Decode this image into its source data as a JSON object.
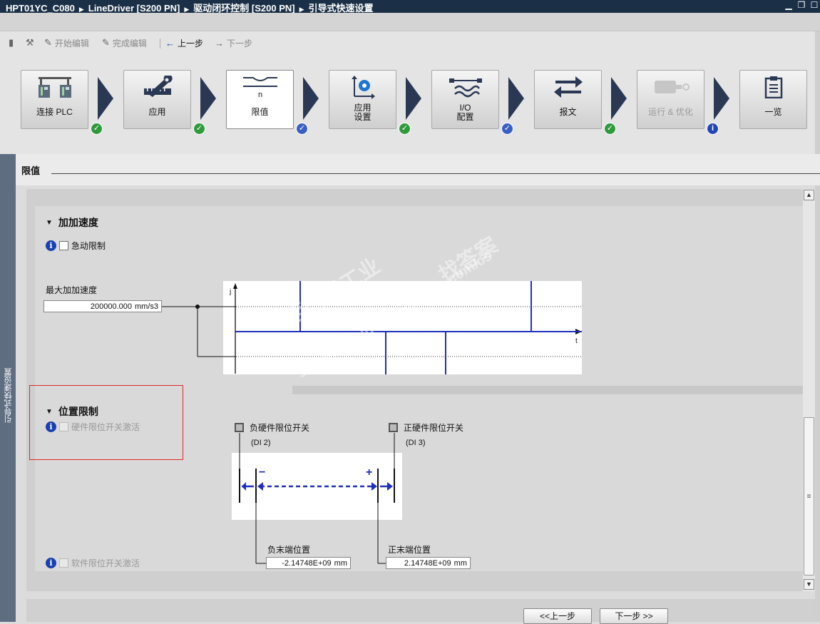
{
  "titlebar": {
    "crumbs": [
      "HPT01YC_C080",
      "LineDriver [S200 PN]",
      "驱动闭环控制 [S200 PN]",
      "引导式快速设置"
    ]
  },
  "toolbar": {
    "start_edit": "开始编辑",
    "finish_edit": "完成编辑",
    "prev": "上一步",
    "next": "下一步"
  },
  "steps": [
    {
      "label": "连接 PLC",
      "status": "ok"
    },
    {
      "label": "应用",
      "status": "ok"
    },
    {
      "label": "限值",
      "status": "done"
    },
    {
      "label": "应用\n设置",
      "status": "ok"
    },
    {
      "label": "I/O\n配置",
      "status": "done"
    },
    {
      "label": "报文",
      "status": "ok"
    },
    {
      "label": "运行 & 优化",
      "status": "info"
    },
    {
      "label": "一览",
      "status": "none"
    }
  ],
  "step_labels": {
    "s1": "连接 PLC",
    "s2": "应用",
    "s3": "限值",
    "s4a": "应用",
    "s4b": "设置",
    "s5a": "I/O",
    "s5b": "配置",
    "s6": "报文",
    "s7": "运行 & 优化",
    "s8": "一览"
  },
  "side_tab": "引导式快速设置",
  "section": {
    "title": "限值"
  },
  "jerk": {
    "header": "加加速度",
    "limit_checkbox": "急动限制",
    "max_label": "最大加加速度",
    "max_value": "200000.000",
    "max_unit": "mm/s3",
    "axis_y": "j",
    "axis_x": "t"
  },
  "position": {
    "header": "位置限制",
    "hw_checkbox": "硬件限位开关激活",
    "neg_hw": "负硬件限位开关",
    "neg_hw_di": "(DI 2)",
    "pos_hw": "正硬件限位开关",
    "pos_hw_di": "(DI 3)",
    "neg_end_label": "负末端位置",
    "neg_end_value": "-2.14748E+09",
    "pos_end_label": "正末端位置",
    "pos_end_value": "2.14748E+09",
    "unit": "mm",
    "sw_checkbox": "软件限位开关激活",
    "minus": "−",
    "plus": "+"
  },
  "footer": {
    "prev_button": "<<上一步",
    "next_button": "下一步 >>"
  },
  "watermark": {
    "line1": "西门子工业",
    "line2": "support.industry.siemens.com/cs",
    "line3": "找答案"
  },
  "colors": {
    "titlebar": "#1b3047",
    "arrow": "#2b3854",
    "ok_badge": "#2f9a3c",
    "info_badge": "#2446b4",
    "plot_line": "#1f2fb8",
    "highlight": "#e0282a"
  }
}
